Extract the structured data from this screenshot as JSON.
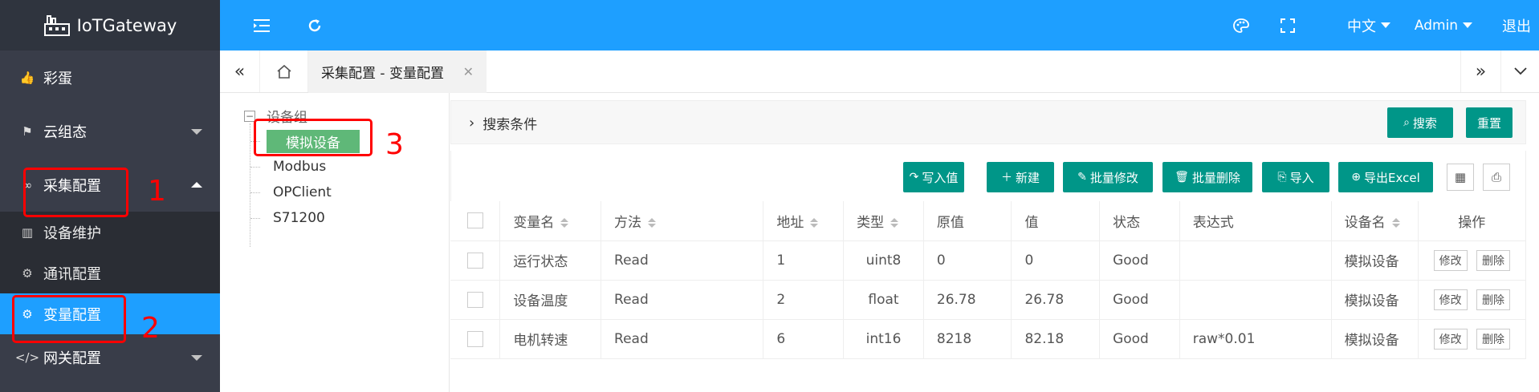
{
  "app": {
    "title": "IoTGateway"
  },
  "sidebar": {
    "items": [
      {
        "label": "彩蛋",
        "icon": "thumbs-up-icon"
      },
      {
        "label": "云组态",
        "icon": "sign-post-icon"
      },
      {
        "label": "采集配置",
        "icon": "link-icon",
        "expanded": true
      },
      {
        "label": "网关配置",
        "icon": "code-icon"
      }
    ],
    "sub_items": [
      {
        "label": "设备维护",
        "icon": "server-icon"
      },
      {
        "label": "通讯配置",
        "icon": "gear-icon"
      },
      {
        "label": "变量配置",
        "icon": "gear-icon",
        "active": true
      }
    ]
  },
  "header": {
    "language": "中文",
    "user": "Admin",
    "logout": "退出"
  },
  "tabs": {
    "active_tab": "采集配置 - 变量配置"
  },
  "tree": {
    "root": "设备组",
    "nodes": [
      "模拟设备",
      "Modbus",
      "OPClient",
      "S71200"
    ],
    "selected": "模拟设备"
  },
  "search": {
    "title": "搜索条件",
    "search_btn": "搜索",
    "reset_btn": "重置"
  },
  "toolbar": {
    "write_value": "写入值",
    "new": "新建",
    "batch_edit": "批量修改",
    "batch_delete": "批量删除",
    "import": "导入",
    "export": "导出Excel"
  },
  "table": {
    "headers": [
      "变量名",
      "方法",
      "地址",
      "类型",
      "原值",
      "值",
      "状态",
      "表达式",
      "设备名",
      "操作"
    ],
    "rows": [
      [
        "运行状态",
        "Read",
        "1",
        "uint8",
        "0",
        "0",
        "Good",
        "",
        "模拟设备"
      ],
      [
        "设备温度",
        "Read",
        "2",
        "float",
        "26.78",
        "26.78",
        "Good",
        "",
        "模拟设备"
      ],
      [
        "电机转速",
        "Read",
        "6",
        "int16",
        "8218",
        "82.18",
        "Good",
        "raw*0.01",
        "模拟设备"
      ]
    ],
    "edit_label": "修改",
    "delete_label": "删除"
  },
  "annotations": [
    "1",
    "2",
    "3"
  ],
  "colors": {
    "header_blue": "#1e9fff",
    "sidebar_dark": "#393d49",
    "button_teal": "#009688",
    "tree_selected": "#5fb878",
    "annotation_red": "#ff0000"
  }
}
